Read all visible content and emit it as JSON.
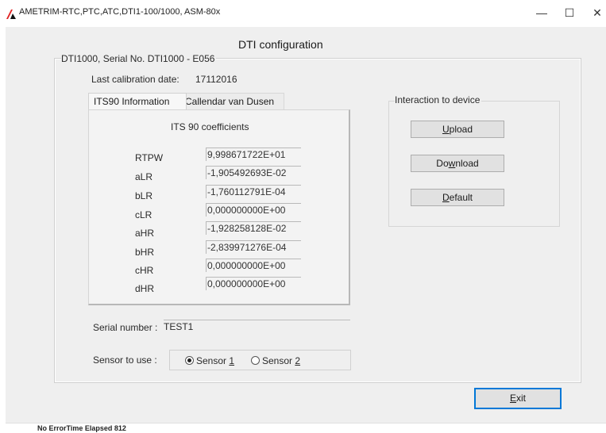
{
  "window": {
    "title": "AMETRIM-RTC,PTC,ATC,DTI1-100/1000, ASM-80x",
    "minimize_glyph": "—",
    "maximize_glyph": "☐",
    "close_glyph": "✕"
  },
  "form": {
    "title": "DTI configuration",
    "group_caption": "DTI1000, Serial No. DTI1000 - E056",
    "calibration_label": "Last calibration date:",
    "calibration_value": "17112016"
  },
  "tabs": [
    {
      "label": "ITS90 Information",
      "active": true
    },
    {
      "label": "Callendar van Dusen",
      "active": false
    }
  ],
  "its90": {
    "title": "ITS 90 coefficients",
    "coefficients": [
      {
        "name": "RTPW",
        "value": "9,998671722E+01"
      },
      {
        "name": "aLR",
        "value": "-1,905492693E-02"
      },
      {
        "name": "bLR",
        "value": "-1,760112791E-04"
      },
      {
        "name": "cLR",
        "value": "0,000000000E+00"
      },
      {
        "name": "aHR",
        "value": "-1,928258128E-02"
      },
      {
        "name": "bHR",
        "value": "-2,839971276E-04"
      },
      {
        "name": "cHR",
        "value": "0,000000000E+00"
      },
      {
        "name": "dHR",
        "value": "0,000000000E+00"
      }
    ]
  },
  "interaction": {
    "caption": "Interaction to device",
    "upload_pre": "",
    "upload_key": "U",
    "upload_post": "pload",
    "download_pre": "Do",
    "download_key": "w",
    "download_post": "nload",
    "default_pre": "",
    "default_key": "D",
    "default_post": "efault"
  },
  "serial": {
    "label": "Serial number :",
    "value": "TEST1"
  },
  "sensor": {
    "label": "Sensor to use :",
    "option1_pre": "Sensor ",
    "option1_key": "1",
    "option2_pre": "Sensor ",
    "option2_key": "2",
    "selected": 1
  },
  "exit": {
    "pre": "",
    "key": "E",
    "post": "xit"
  },
  "status": {
    "text": "No ErrorTime Elapsed 812"
  },
  "colors": {
    "accent": "#0078d7",
    "logo_red": "#e02020",
    "logo_black": "#111111"
  }
}
